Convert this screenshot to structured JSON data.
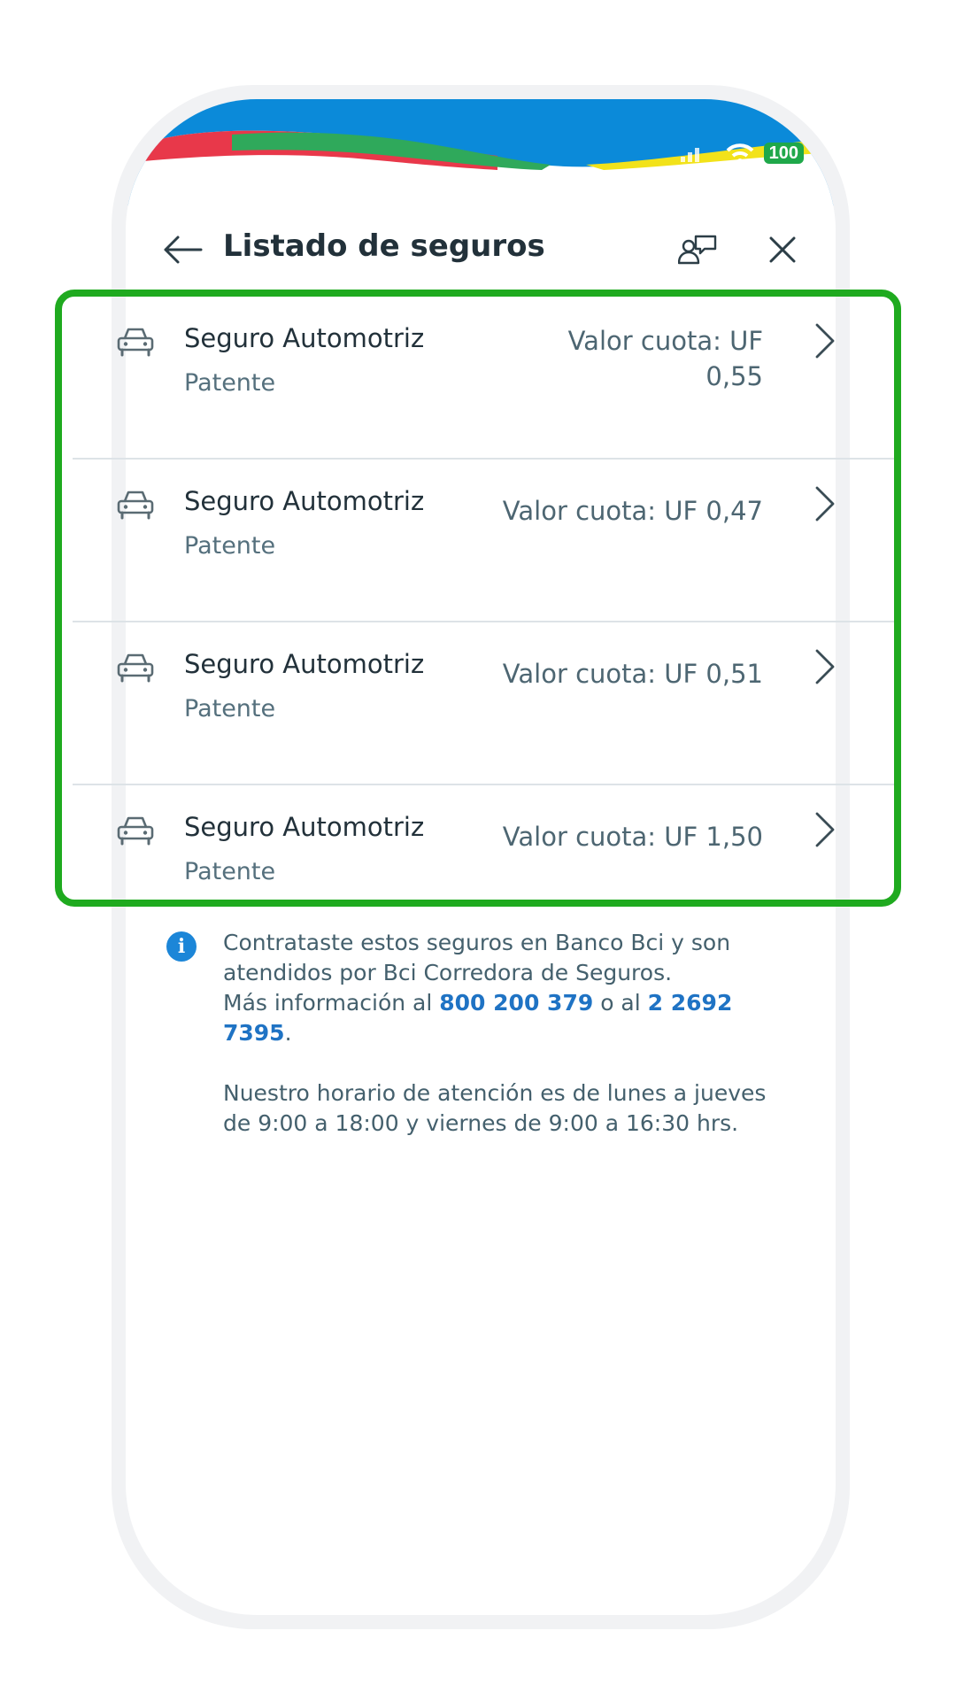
{
  "status_bar": {
    "battery": "100"
  },
  "header": {
    "title": "Listado de seguros",
    "back_icon": "arrow-left-icon",
    "contact_icon": "person-chat-icon",
    "close_icon": "close-icon"
  },
  "insurance_list": [
    {
      "title": "Seguro Automotriz",
      "subtitle": "Patente",
      "value": "Valor cuota: UF 0,55",
      "icon": "car-icon"
    },
    {
      "title": "Seguro Automotriz",
      "subtitle": "Patente",
      "value": "Valor cuota: UF 0,47",
      "icon": "car-icon"
    },
    {
      "title": "Seguro Automotriz",
      "subtitle": "Patente",
      "value": "Valor cuota: UF 0,51",
      "icon": "car-icon"
    },
    {
      "title": "Seguro Automotriz",
      "subtitle": "Patente",
      "value": "Valor cuota: UF 1,50",
      "icon": "car-icon"
    }
  ],
  "info": {
    "text_1": "Contrataste estos seguros en Banco Bci y son atendidos por Bci Corredora de Seguros.",
    "more_info_prefix": "Más información al",
    "phone_1": "800 200 379",
    "or": "o al",
    "phone_2": "2 2692 7395",
    "end": ".",
    "schedule": "Nuestro horario de atención es de lunes a jueves de 9:00 a 18:00 y viernes de 9:00 a 16:30 hrs."
  },
  "colors": {
    "banner_blue": "#0b8ad9",
    "highlight_green": "#1faa1f",
    "link_blue": "#1f73c4",
    "info_icon_blue": "#1c86d8"
  }
}
